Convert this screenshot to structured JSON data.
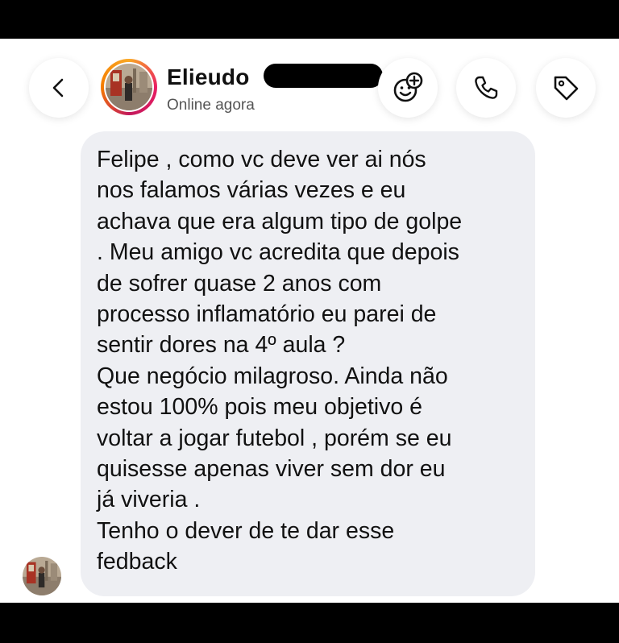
{
  "header": {
    "contact_name": "Elieudo",
    "status": "Online agora"
  },
  "icons": {
    "back": "chevron-left-icon",
    "effects": "sticker-effects-icon",
    "call": "phone-icon",
    "tag": "tag-icon"
  },
  "message": {
    "text": "Felipe , como vc deve ver ai nós\nnos falamos várias vezes e eu\nachava que era algum tipo de golpe\n. Meu amigo vc acredita que depois\nde sofrer quase 2 anos com\nprocesso inflamatório eu parei de\nsentir dores na 4º aula ?\nQue negócio milagroso. Ainda não\nestou 100% pois meu objetivo é\nvoltar a jogar futebol , porém se eu\nquisesse apenas viver sem dor eu\njá viveria .\nTenho o dever de te dar esse\nfedback"
  },
  "colors": {
    "bubble": "#eeeff3",
    "story_ring": "#e91e63",
    "background": "#ffffff"
  }
}
